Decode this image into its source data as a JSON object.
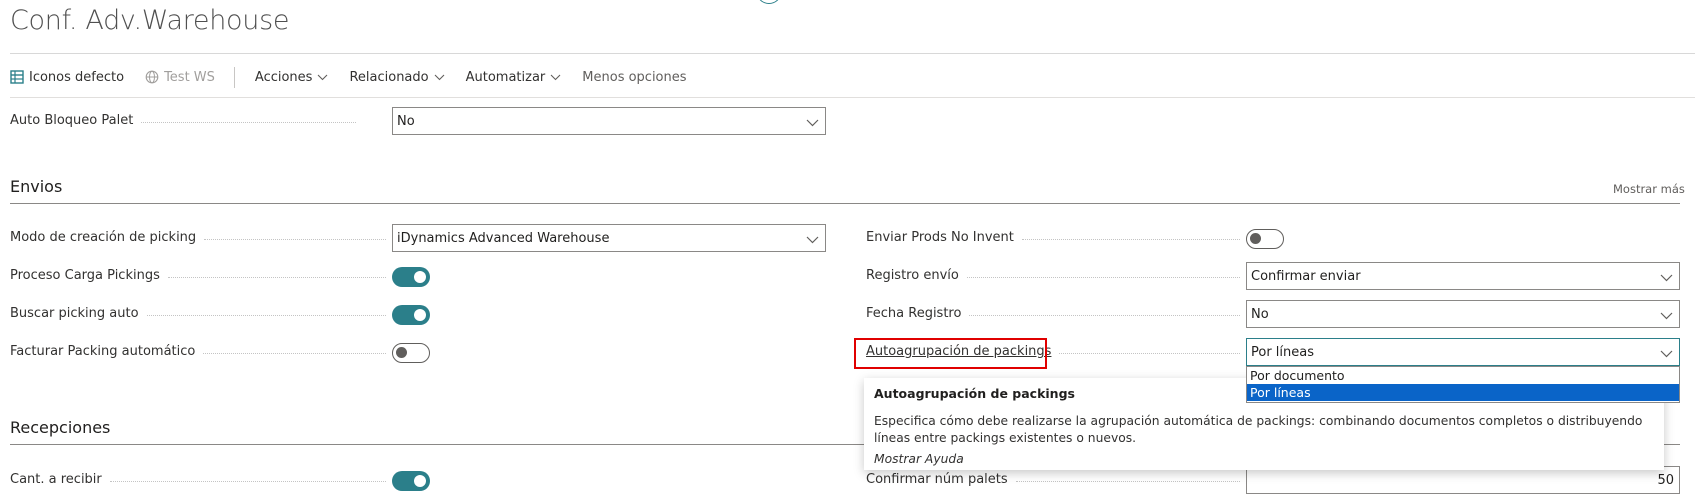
{
  "page": {
    "title": "Conf. Adv.Warehouse"
  },
  "toolbar": {
    "items": [
      {
        "label": "Iconos defecto"
      },
      {
        "label": "Test WS"
      },
      {
        "label": "Acciones"
      },
      {
        "label": "Relacionado"
      },
      {
        "label": "Automatizar"
      },
      {
        "label": "Menos opciones"
      }
    ]
  },
  "top_fields": {
    "auto_bloqueo_palet": {
      "label": "Auto Bloqueo Palet",
      "value": "No"
    }
  },
  "envios": {
    "title": "Envios",
    "show_more": "Mostrar más",
    "left": [
      {
        "label": "Modo de creación de picking",
        "type": "select",
        "value": "iDynamics Advanced Warehouse"
      },
      {
        "label": "Proceso Carga Pickings",
        "type": "toggle",
        "on": true
      },
      {
        "label": "Buscar picking auto",
        "type": "toggle",
        "on": true
      },
      {
        "label": "Facturar Packing automático",
        "type": "toggle",
        "on": false
      }
    ],
    "right": [
      {
        "label": "Enviar Prods No Invent",
        "type": "toggle",
        "on": false
      },
      {
        "label": "Registro envío",
        "type": "select",
        "value": "Confirmar enviar"
      },
      {
        "label": "Fecha Registro",
        "type": "select",
        "value": "No"
      },
      {
        "label": "Autoagrupación de packings",
        "type": "select",
        "value": "Por líneas"
      }
    ]
  },
  "dropdown": {
    "options": [
      "Por documento",
      "Por líneas"
    ],
    "selected": "Por líneas"
  },
  "tooltip": {
    "title": "Autoagrupación de packings",
    "body": "Especifica cómo debe realizarse la agrupación automática de packings: combinando documentos completos o distribuyendo líneas entre packings existentes o nuevos.",
    "more": "Mostrar Ayuda"
  },
  "recepciones": {
    "title": "Recepciones",
    "left": [
      {
        "label": "Cant. a recibir",
        "type": "toggle",
        "on": true
      }
    ],
    "right": [
      {
        "label": "Confirmar núm palets",
        "type": "number",
        "value": "50"
      }
    ]
  },
  "colors": {
    "accent": "#2b7f8a",
    "highlight": "#e00000",
    "selection": "#0a64c8"
  }
}
